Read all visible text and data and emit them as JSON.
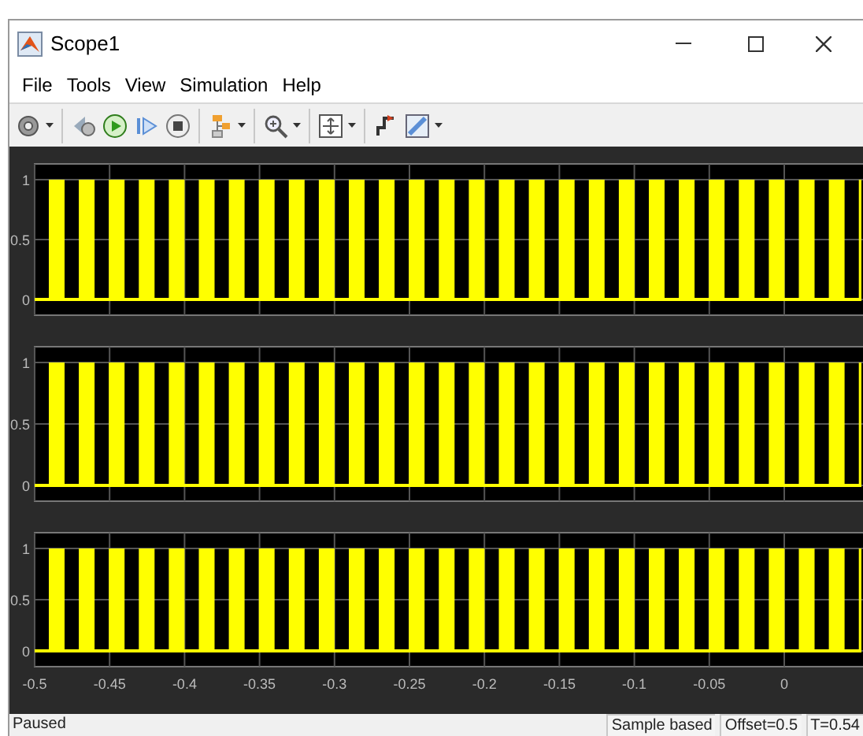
{
  "window": {
    "title": "Scope1"
  },
  "menu": [
    "File",
    "Tools",
    "View",
    "Simulation",
    "Help"
  ],
  "toolbar": [
    {
      "kind": "settings",
      "dropdown": true
    },
    {
      "kind": "step-back",
      "dropdown": false
    },
    {
      "kind": "run",
      "dropdown": false
    },
    {
      "kind": "step-forward",
      "dropdown": false
    },
    {
      "kind": "stop",
      "dropdown": false
    },
    {
      "kind": "highlight",
      "dropdown": true
    },
    {
      "kind": "zoom",
      "dropdown": true
    },
    {
      "kind": "fit",
      "dropdown": true
    },
    {
      "kind": "triggers",
      "dropdown": false
    },
    {
      "kind": "measure",
      "dropdown": true
    }
  ],
  "plots": [
    {
      "y_ticks": [
        "1",
        "0.5",
        "0"
      ]
    },
    {
      "y_ticks": [
        "1",
        "0.5",
        "0"
      ]
    },
    {
      "y_ticks": [
        "1",
        "0.5",
        "0"
      ]
    }
  ],
  "x_ticks": [
    "-0.5",
    "-0.45",
    "-0.4",
    "-0.35",
    "-0.3",
    "-0.25",
    "-0.2",
    "-0.15",
    "-0.1",
    "-0.05",
    "0"
  ],
  "status_bar": {
    "state": "Paused",
    "fields": [
      "Sample based",
      "Offset=0.5",
      "T=0.54"
    ]
  }
}
